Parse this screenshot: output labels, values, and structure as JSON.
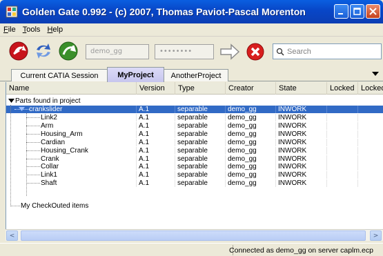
{
  "window": {
    "title": "Golden Gate 0.992 - (c) 2007, Thomas Paviot-Pascal Morenton"
  },
  "menu": {
    "items": [
      "File",
      "Tools",
      "Help"
    ]
  },
  "toolbar": {
    "user_field": "demo_gg",
    "password_field": "••••••••",
    "search_placeholder": "Search",
    "icons": [
      "catia-connect-icon",
      "sync-icon",
      "checkin-icon",
      "arrow-right-icon",
      "disconnect-icon",
      "search-icon"
    ],
    "colors": {
      "red": "#c8141b",
      "blue": "#2f5fbf",
      "green": "#3a8f2a"
    }
  },
  "tabs": [
    {
      "label": "Current CATIA Session",
      "active": false
    },
    {
      "label": "MyProject",
      "active": true
    },
    {
      "label": "AnotherProject",
      "active": false
    }
  ],
  "table": {
    "columns": [
      "Name",
      "Version",
      "Type",
      "Creator",
      "State",
      "Locked",
      "Locked"
    ],
    "group_root": "Parts found in project",
    "selected_item": {
      "name": "crankslider",
      "version": "A.1",
      "type": "separable",
      "creator": "demo_gg",
      "state": "INWORK"
    },
    "rows": [
      {
        "name": "Link2",
        "version": "A.1",
        "type": "separable",
        "creator": "demo_gg",
        "state": "INWORK"
      },
      {
        "name": "Arm",
        "version": "A.1",
        "type": "separable",
        "creator": "demo_gg",
        "state": "INWORK"
      },
      {
        "name": "Housing_Arm",
        "version": "A.1",
        "type": "separable",
        "creator": "demo_gg",
        "state": "INWORK"
      },
      {
        "name": "Cardian",
        "version": "A.1",
        "type": "separable",
        "creator": "demo_gg",
        "state": "INWORK"
      },
      {
        "name": "Housing_Crank",
        "version": "A.1",
        "type": "separable",
        "creator": "demo_gg",
        "state": "INWORK"
      },
      {
        "name": "Crank",
        "version": "A.1",
        "type": "separable",
        "creator": "demo_gg",
        "state": "INWORK"
      },
      {
        "name": "Collar",
        "version": "A.1",
        "type": "separable",
        "creator": "demo_gg",
        "state": "INWORK"
      },
      {
        "name": "Link1",
        "version": "A.1",
        "type": "separable",
        "creator": "demo_gg",
        "state": "INWORK"
      },
      {
        "name": "Shaft",
        "version": "A.1",
        "type": "separable",
        "creator": "demo_gg",
        "state": "INWORK"
      }
    ],
    "checkout_group": "My CheckOuted items",
    "selection_color": "#316ac5"
  },
  "scrollbar": {
    "left_arrow": "<",
    "right_arrow": ">"
  },
  "status": {
    "text": "Connected as demo_gg on server caplm.ecp"
  }
}
